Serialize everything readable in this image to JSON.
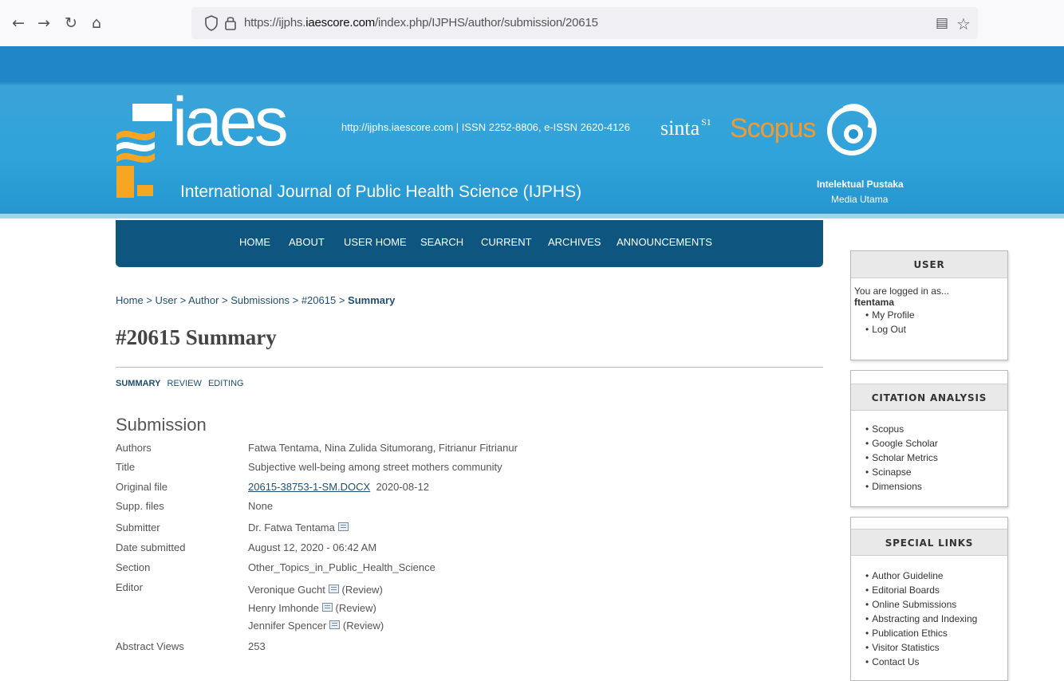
{
  "browser": {
    "back_icon": "←",
    "forward_icon": "→",
    "reload_icon": "↻",
    "home_icon": "⌂",
    "url_prefix": "https://ijphs.",
    "url_host": "iaescore.com",
    "url_suffix": "/index.php/IJPHS/author/submission/20615",
    "reader_icon": "▤",
    "bookmark_icon": "☆"
  },
  "header": {
    "logo_text": "iaes",
    "journal_title": "International Journal of Public Health Science (IJPHS)",
    "issn_line": "http://ijphs.iaescore.com  |  ISSN 2252-8806, e-ISSN 2620-4126",
    "sinta_label": "sinta",
    "sinta_badge": "S1",
    "scopus_label": "Scopus",
    "publisher_name": "Intelektual Pustaka",
    "publisher_sub": "Media Utama",
    "brand_color": "#2186c6",
    "nav_color": "#0e5580"
  },
  "nav": {
    "items": [
      "HOME",
      "ABOUT",
      "USER HOME",
      "SEARCH",
      "CURRENT",
      "ARCHIVES",
      "ANNOUNCEMENTS"
    ]
  },
  "breadcrumb": {
    "items": [
      "Home",
      "User",
      "Author",
      "Submissions",
      "#20615"
    ],
    "separator": ">",
    "current": "Summary"
  },
  "page": {
    "title": "#20615 Summary",
    "subtabs": [
      "SUMMARY",
      "REVIEW",
      "EDITING"
    ],
    "section_heading": "Submission"
  },
  "submission": {
    "authors_label": "Authors",
    "authors": "Fatwa Tentama, Nina Zulida Situmorang, Fitrianur Fitrianur",
    "title_label": "Title",
    "title": "Subjective well-being among street mothers community",
    "original_file_label": "Original file",
    "original_file_name": "20615-38753-1-SM.DOCX",
    "original_file_date": "2020-08-12",
    "supp_files_label": "Supp. files",
    "supp_files": "None",
    "submitter_label": "Submitter",
    "submitter": "Dr. Fatwa Tentama",
    "date_submitted_label": "Date submitted",
    "date_submitted": "August 12, 2020 - 06:42 AM",
    "section_label": "Section",
    "section": "Other_Topics_in_Public_Health_Science",
    "editor_label": "Editor",
    "editors": [
      {
        "name": "Veronique Gucht",
        "role": "(Review)"
      },
      {
        "name": "Henry Imhonde",
        "role": "(Review)"
      },
      {
        "name": "Jennifer Spencer",
        "role": "(Review)"
      }
    ],
    "abstract_views_label": "Abstract Views",
    "abstract_views": "253"
  },
  "sidebar": {
    "user": {
      "heading": "USER",
      "logged_in_text": "You are logged in as...",
      "username": "ftentama",
      "links": [
        "My Profile",
        "Log Out"
      ]
    },
    "citation": {
      "heading": "CITATION ANALYSIS",
      "links": [
        "Scopus",
        "Google Scholar",
        "Scholar Metrics",
        "Scinapse",
        "Dimensions"
      ]
    },
    "special": {
      "heading": "SPECIAL LINKS",
      "links": [
        "Author Guideline",
        "Editorial Boards",
        "Online Submissions",
        "Abstracting and Indexing",
        "Publication Ethics",
        "Visitor Statistics",
        "Contact Us"
      ]
    }
  }
}
